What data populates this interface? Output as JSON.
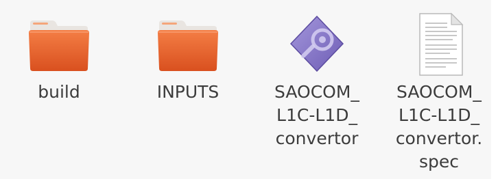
{
  "files": [
    {
      "icon": "folder-icon",
      "label_lines": [
        "build"
      ]
    },
    {
      "icon": "folder-icon",
      "label_lines": [
        "INPUTS"
      ]
    },
    {
      "icon": "executable-icon",
      "label_lines": [
        "SAOCOM_",
        "L1C-L1D_",
        "convertor"
      ]
    },
    {
      "icon": "text-document-icon",
      "label_lines": [
        "SAOCOM_",
        "L1C-L1D_",
        "convertor.",
        "spec"
      ]
    }
  ],
  "colors": {
    "background": "#f7f7f7",
    "label_text": "#3c3c3c",
    "folder_orange": "#f06f38",
    "folder_dark": "#d35a2a",
    "folder_tab": "#f5c6a8",
    "executable_purple": "#8a79c9"
  }
}
